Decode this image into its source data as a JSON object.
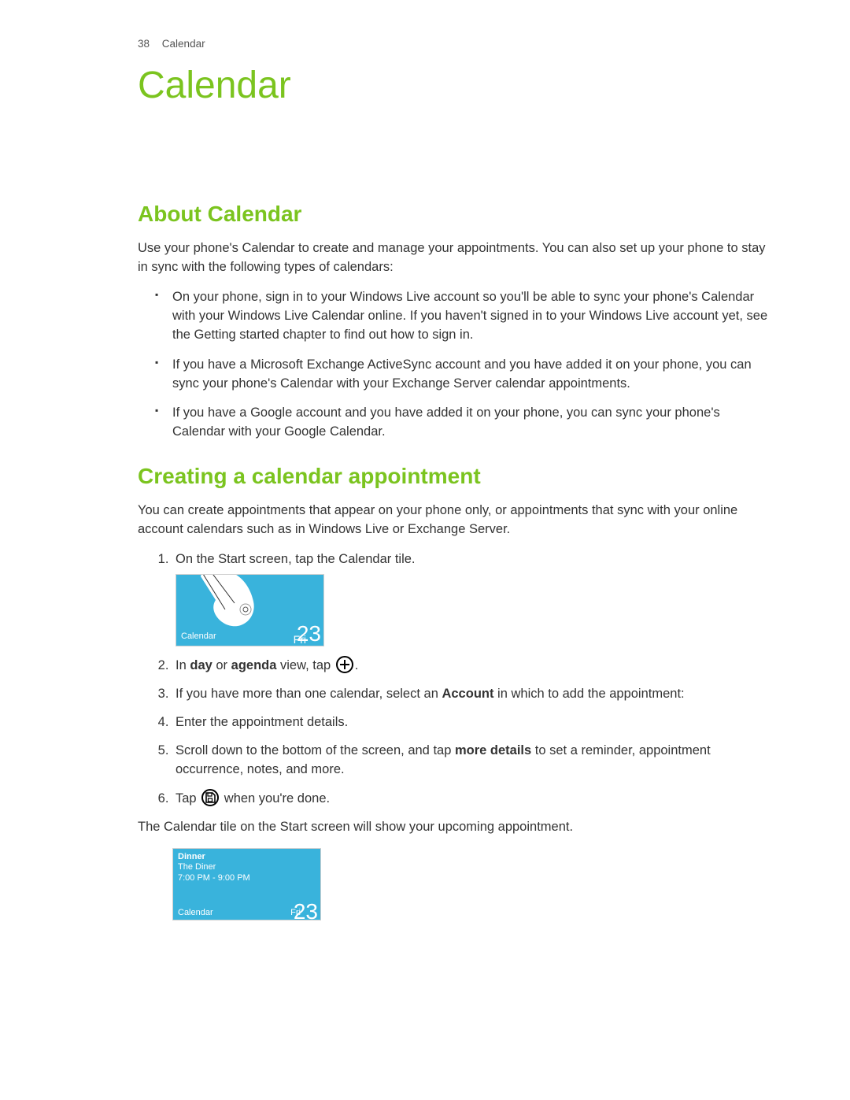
{
  "header": {
    "page_number": "38",
    "running_title": "Calendar"
  },
  "chapter_title": "Calendar",
  "section1": {
    "title": "About Calendar",
    "intro": "Use your phone's Calendar to create and manage your appointments. You can also set up your phone to stay in sync with the following types of calendars:",
    "bullets": [
      "On your phone, sign in to your Windows Live account so you'll be able to sync your phone's Calendar with your Windows Live Calendar online. If you haven't signed in to your Windows Live account yet, see the Getting started chapter to find out how to sign in.",
      "If you have a Microsoft Exchange ActiveSync account and you have added it on your phone, you can sync your phone's Calendar with your Exchange Server calendar appointments.",
      "If you have a Google account and you have added it on your phone, you can sync your phone's Calendar with your Google Calendar."
    ]
  },
  "section2": {
    "title": "Creating a calendar appointment",
    "intro": "You can create appointments that appear on your phone only, or appointments that sync with your online account calendars such as in Windows Live or Exchange Server.",
    "steps": {
      "s1": "On the Start screen, tap the Calendar tile.",
      "s2_pre": "In ",
      "s2_b1": "day",
      "s2_mid": " or ",
      "s2_b2": "agenda",
      "s2_post": " view, tap ",
      "s2_end": ".",
      "s3_pre": "If you have more than one calendar, select an ",
      "s3_b": "Account",
      "s3_post": " in which to add the appointment:",
      "s4": "Enter the appointment details.",
      "s5_pre": "Scroll down to the bottom of the screen, and tap ",
      "s5_b": "more details",
      "s5_post": " to set a reminder, appointment occurrence, notes, and more.",
      "s6_pre": "Tap ",
      "s6_post": " when you're done."
    },
    "closing": "The Calendar tile on the Start screen will show your upcoming appointment."
  },
  "tile1": {
    "label": "Calendar",
    "day": "Fri",
    "num": "23"
  },
  "tile2": {
    "line1": "Dinner",
    "line2": "The Diner",
    "line3": "7:00 PM - 9:00 PM",
    "label": "Calendar",
    "day": "Fri",
    "num": "23"
  }
}
